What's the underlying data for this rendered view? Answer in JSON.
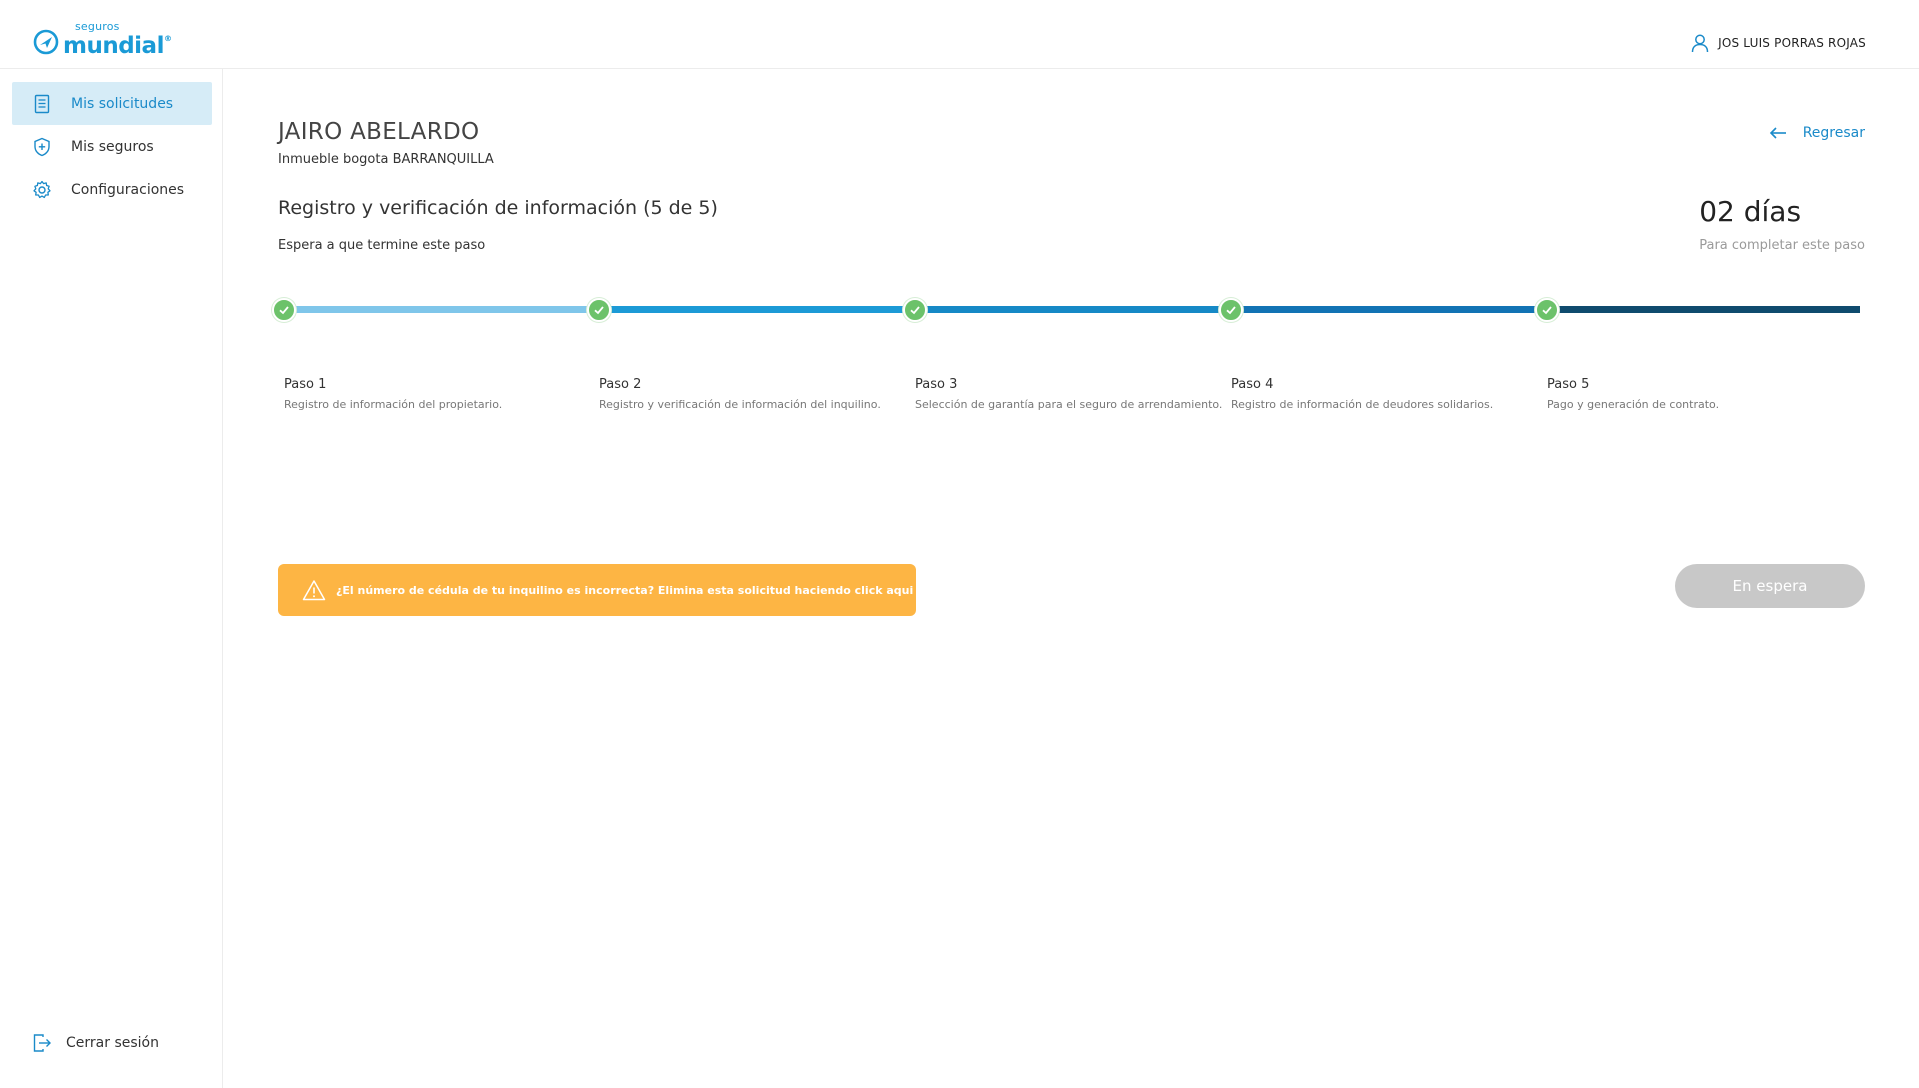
{
  "header": {
    "logo_small": "seguros",
    "logo_big": "mundial",
    "logo_reg": "®",
    "user_name": "JOS LUIS PORRAS ROJAS"
  },
  "sidebar": {
    "items": [
      {
        "label": "Mis solicitudes",
        "icon": "document-icon",
        "active": true
      },
      {
        "label": "Mis seguros",
        "icon": "shield-plus-icon",
        "active": false
      },
      {
        "label": "Configuraciones",
        "icon": "gear-icon",
        "active": false
      }
    ],
    "logout_label": "Cerrar sesión"
  },
  "main": {
    "client_name": "JAIRO ABELARDO",
    "property": "Inmueble bogota BARRANQUILLA",
    "back_label": "Regresar",
    "step_title": "Registro y verificación de información (5 de 5)",
    "step_subtitle": "Espera a que termine este paso",
    "days_value": "02 días",
    "days_caption": "Para completar este paso",
    "steps": [
      {
        "name": "Paso 1",
        "desc": "Registro de información del propietario.",
        "done": true
      },
      {
        "name": "Paso 2",
        "desc": "Registro y verificación de información del inquilino.",
        "done": true
      },
      {
        "name": "Paso 3",
        "desc": "Selección de garantía para el seguro de arrendamiento.",
        "done": true
      },
      {
        "name": "Paso 4",
        "desc": "Registro de información de deudores solidarios.",
        "done": true
      },
      {
        "name": "Paso 5",
        "desc": "Pago y generación de contrato.",
        "done": true
      }
    ],
    "segment_colors": [
      "#7fc6ea",
      "#1c9ad6",
      "#1689c6",
      "#1273b4",
      "#0f4b6e"
    ],
    "warning_text": "¿El número de cédula de tu inquilino es incorrecta? Elimina esta solicitud haciendo click aqui",
    "wait_button": "En espera"
  },
  "colors": {
    "accent": "#1a8ac9",
    "check_green": "#6cc26a",
    "warning": "#fdb544",
    "disabled_button": "#c8c8c8",
    "active_nav_bg": "#d6ecf7"
  }
}
